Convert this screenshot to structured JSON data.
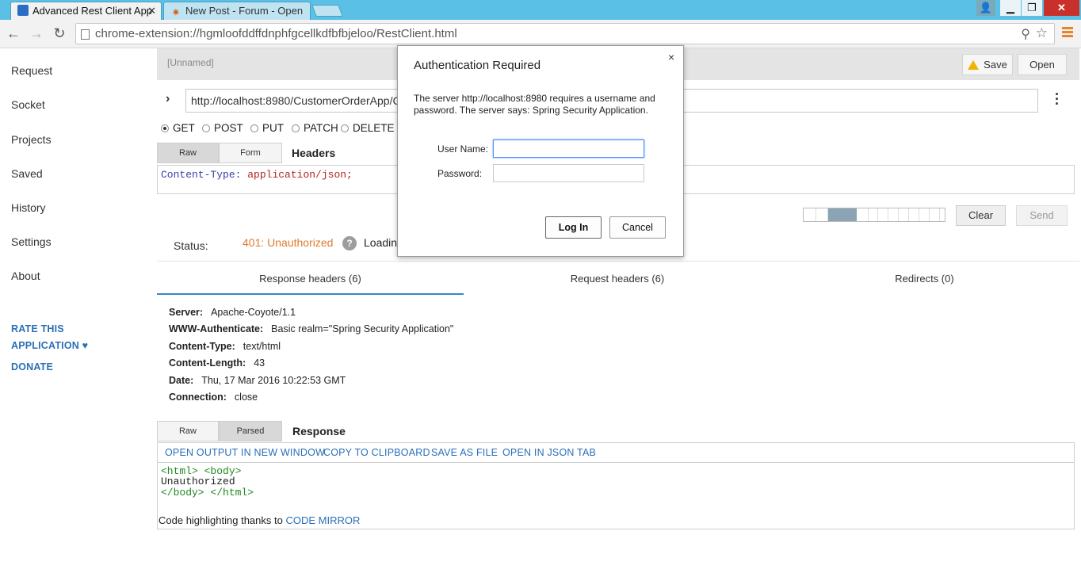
{
  "browser": {
    "tabs": [
      {
        "title": "Advanced Rest Client App"
      },
      {
        "title": "New Post - Forum - Open"
      }
    ],
    "url_prefix": "chrome-extension://",
    "url_host": "hgmloofddffdnphfgcellkdfbfbjeloo",
    "url_path": "/RestClient.html",
    "accent_menu_color": "#e8832f"
  },
  "sidebar": {
    "items": [
      {
        "label": "Request"
      },
      {
        "label": "Socket"
      },
      {
        "label": "Projects"
      },
      {
        "label": "Saved"
      },
      {
        "label": "History"
      },
      {
        "label": "Settings"
      },
      {
        "label": "About"
      }
    ],
    "rate_line1": "RATE THIS",
    "rate_line2": "APPLICATION ♥",
    "donate": "DONATE"
  },
  "request": {
    "name": "[Unnamed]",
    "save_label": "Save",
    "open_label": "Open",
    "url_value": "http://localhost:8980/CustomerOrderApp/C",
    "methods": [
      {
        "label": "GET",
        "checked": true
      },
      {
        "label": "POST",
        "checked": false
      },
      {
        "label": "PUT",
        "checked": false
      },
      {
        "label": "PATCH",
        "checked": false
      },
      {
        "label": "DELETE",
        "checked": false
      }
    ],
    "headers_tabs": {
      "raw": "Raw",
      "form": "Form"
    },
    "headers_title": "Headers",
    "header_key": "Content-Type:",
    "header_value": "application/json;",
    "clear_label": "Clear",
    "send_label": "Send"
  },
  "status": {
    "label": "Status:",
    "value": "401: Unauthorized",
    "help": "?",
    "loading": "Loadin",
    "status_color": "#e07a2e"
  },
  "response_tabs": [
    {
      "label": "Response headers (6)",
      "active": true
    },
    {
      "label": "Request headers (6)",
      "active": false
    },
    {
      "label": "Redirects (0)",
      "active": false
    }
  ],
  "response_headers": [
    {
      "name": "Server:",
      "value": "Apache-Coyote/1.1"
    },
    {
      "name": "WWW-Authenticate:",
      "value": "Basic realm=\"Spring Security Application\""
    },
    {
      "name": "Content-Type:",
      "value": "text/html"
    },
    {
      "name": "Content-Length:",
      "value": "43"
    },
    {
      "name": "Date:",
      "value": "Thu, 17 Mar 2016 10:22:53 GMT"
    },
    {
      "name": "Connection:",
      "value": "close"
    }
  ],
  "response": {
    "tabs": {
      "raw": "Raw",
      "parsed": "Parsed"
    },
    "title": "Response",
    "actions": [
      "OPEN OUTPUT IN NEW WINDOW",
      "COPY TO CLIPBOARD",
      "SAVE AS FILE",
      "OPEN IN JSON TAB"
    ],
    "code_line1": "<html> <body>",
    "code_line2": "Unauthorized",
    "code_line3": "</body> </html>",
    "credit_text": "Code highlighting thanks to ",
    "credit_link": "CODE MIRROR"
  },
  "auth_dialog": {
    "title": "Authentication Required",
    "close": "×",
    "message": "The server http://localhost:8980 requires a username and password. The server says: Spring Security Application.",
    "username_label": "User Name:",
    "password_label": "Password:",
    "username_value": "",
    "password_value": "",
    "login_label": "Log In",
    "cancel_label": "Cancel"
  }
}
